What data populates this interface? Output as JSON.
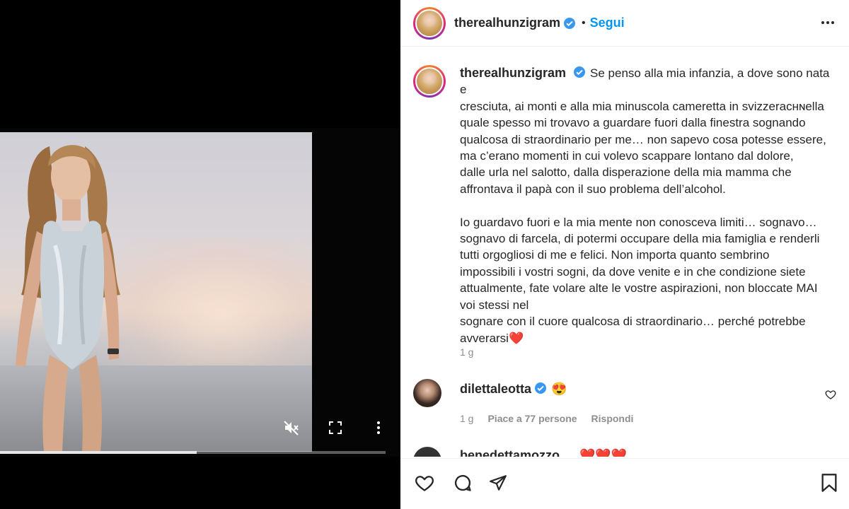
{
  "post": {
    "author": "therealhunzigram",
    "follow_label": "Segui",
    "dot": "•",
    "caption_lines": [
      "Se penso alla mia infanzia, a dove sono nata e",
      "cresciuta, ai monti e alla mia minuscola cameretta in svizzeraᴄʜɴella",
      "quale spesso mi trovavo a guardare fuori dalla finestra sognando",
      "qualcosa di straordinario per me… non sapevo cosa potesse essere,",
      "ma c’erano momenti in cui volevo scappare lontano dal dolore,",
      "dalle urla nel salotto, dalla disperazione della mia mamma che",
      "affrontava il papà con il suo problema dell’alcohol.",
      "",
      "Io guardavo fuori e la mia mente non conosceva limiti… sognavo…",
      "sognavo di farcela, di potermi occupare della mia famiglia e renderli",
      "tutti orgogliosi di me e felici. Non importa quanto sembrino",
      "impossibili i vostri sogni, da dove venite e in che condizione siete",
      "attualmente, fate volare alte le vostre aspirazioni, non bloccate MAI",
      "voi stessi nel",
      "sognare con il cuore qualcosa di straordinario… perché potrebbe",
      "avverarsi"
    ],
    "caption_emoji": "❤️",
    "caption_time": "1 g"
  },
  "comments": [
    {
      "username": "dilettaleotta",
      "text": "😍",
      "time": "1 g",
      "likes": "Piace a 77 persone",
      "reply": "Rispondi"
    },
    {
      "username": "benedettamozzo",
      "text": "❤️❤️❤️"
    }
  ],
  "video": {
    "progress": 0.51
  },
  "icons": {
    "verified": "verified-badge-icon",
    "more": "more-options-icon",
    "mute": "volume-muted-icon",
    "fullscreen": "fullscreen-icon",
    "video_more": "video-more-icon",
    "like": "heart-icon",
    "comment": "comment-icon",
    "share": "share-icon",
    "save": "bookmark-icon"
  },
  "colors": {
    "accent": "#0095f6",
    "verified": "#3897f0",
    "muted_text": "#8e8e8e",
    "heart": "#ed4956"
  }
}
